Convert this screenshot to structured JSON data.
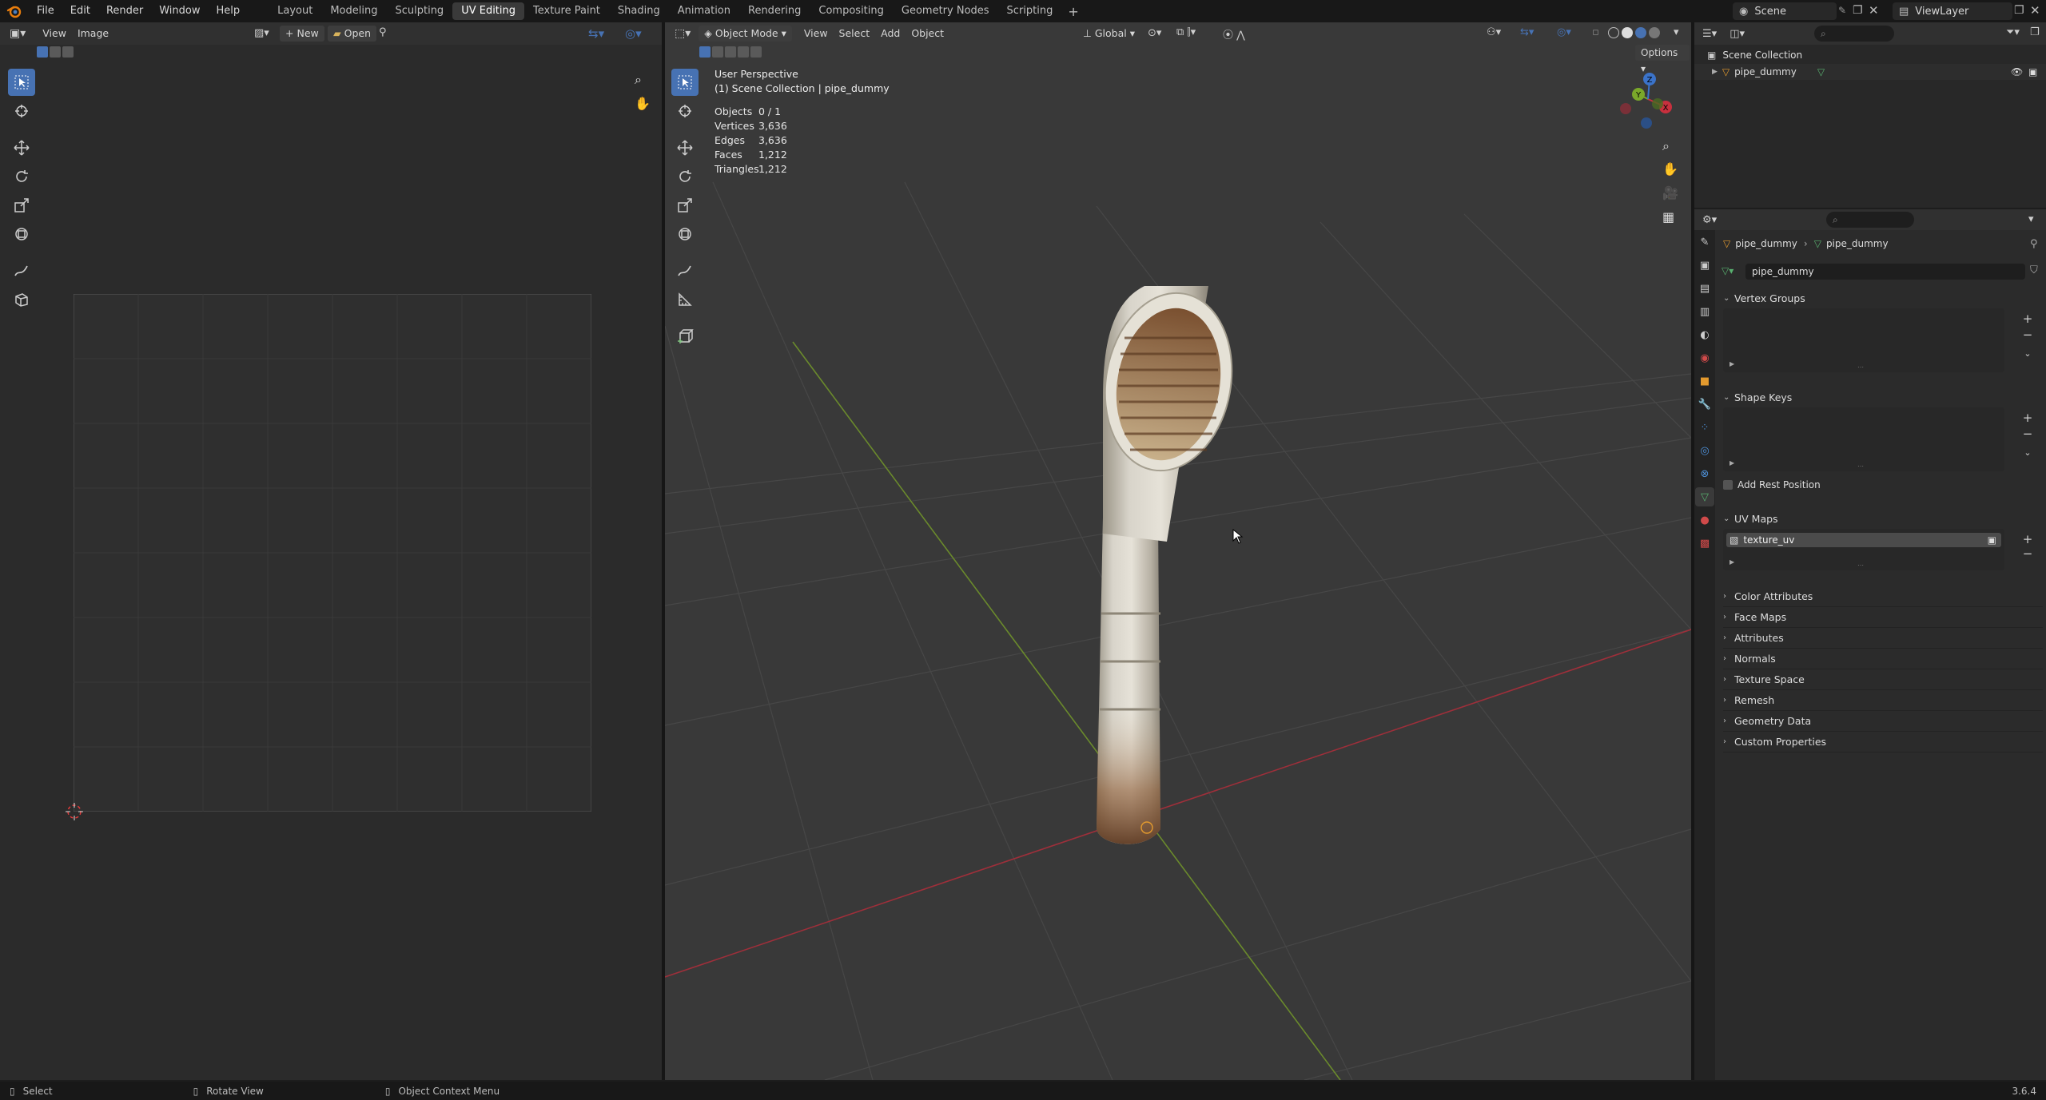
{
  "topbar": {
    "menus": [
      "File",
      "Edit",
      "Render",
      "Window",
      "Help"
    ],
    "workspaces": [
      "Layout",
      "Modeling",
      "Sculpting",
      "UV Editing",
      "Texture Paint",
      "Shading",
      "Animation",
      "Rendering",
      "Compositing",
      "Geometry Nodes",
      "Scripting"
    ],
    "active_workspace": "UV Editing",
    "scene": "Scene",
    "view_layer": "ViewLayer"
  },
  "uv_editor": {
    "menus": [
      "View",
      "Image"
    ],
    "new_label": "New",
    "open_label": "Open"
  },
  "viewport": {
    "mode": "Object Mode",
    "menus": [
      "View",
      "Select",
      "Add",
      "Object"
    ],
    "orientation": "Global",
    "options_label": "Options",
    "perspective": "User Perspective",
    "collection_line": "(1) Scene Collection | pipe_dummy",
    "stats": [
      {
        "label": "Objects",
        "value": "0 / 1"
      },
      {
        "label": "Vertices",
        "value": "3,636"
      },
      {
        "label": "Edges",
        "value": "3,636"
      },
      {
        "label": "Faces",
        "value": "1,212"
      },
      {
        "label": "Triangles",
        "value": "1,212"
      }
    ],
    "gizmo_axes": [
      "X",
      "Y",
      "Z"
    ]
  },
  "outliner": {
    "scene_collection": "Scene Collection",
    "object": "pipe_dummy"
  },
  "properties": {
    "breadcrumb_object": "pipe_dummy",
    "breadcrumb_mesh": "pipe_dummy",
    "mesh_name": "pipe_dummy",
    "vertex_groups": "Vertex Groups",
    "shape_keys": "Shape Keys",
    "add_rest_position": "Add Rest Position",
    "uv_maps": "UV Maps",
    "uv_map_item": "texture_uv",
    "collapsed_panels": [
      "Color Attributes",
      "Face Maps",
      "Attributes",
      "Normals",
      "Texture Space",
      "Remesh",
      "Geometry Data",
      "Custom Properties"
    ]
  },
  "statusbar": {
    "select": "Select",
    "rotate": "Rotate View",
    "context": "Object Context Menu",
    "version": "3.6.4"
  },
  "colors": {
    "accent": "#4772b3",
    "x_axis": "#c8303e",
    "y_axis": "#7aa82a",
    "z_axis": "#3b73c9"
  }
}
